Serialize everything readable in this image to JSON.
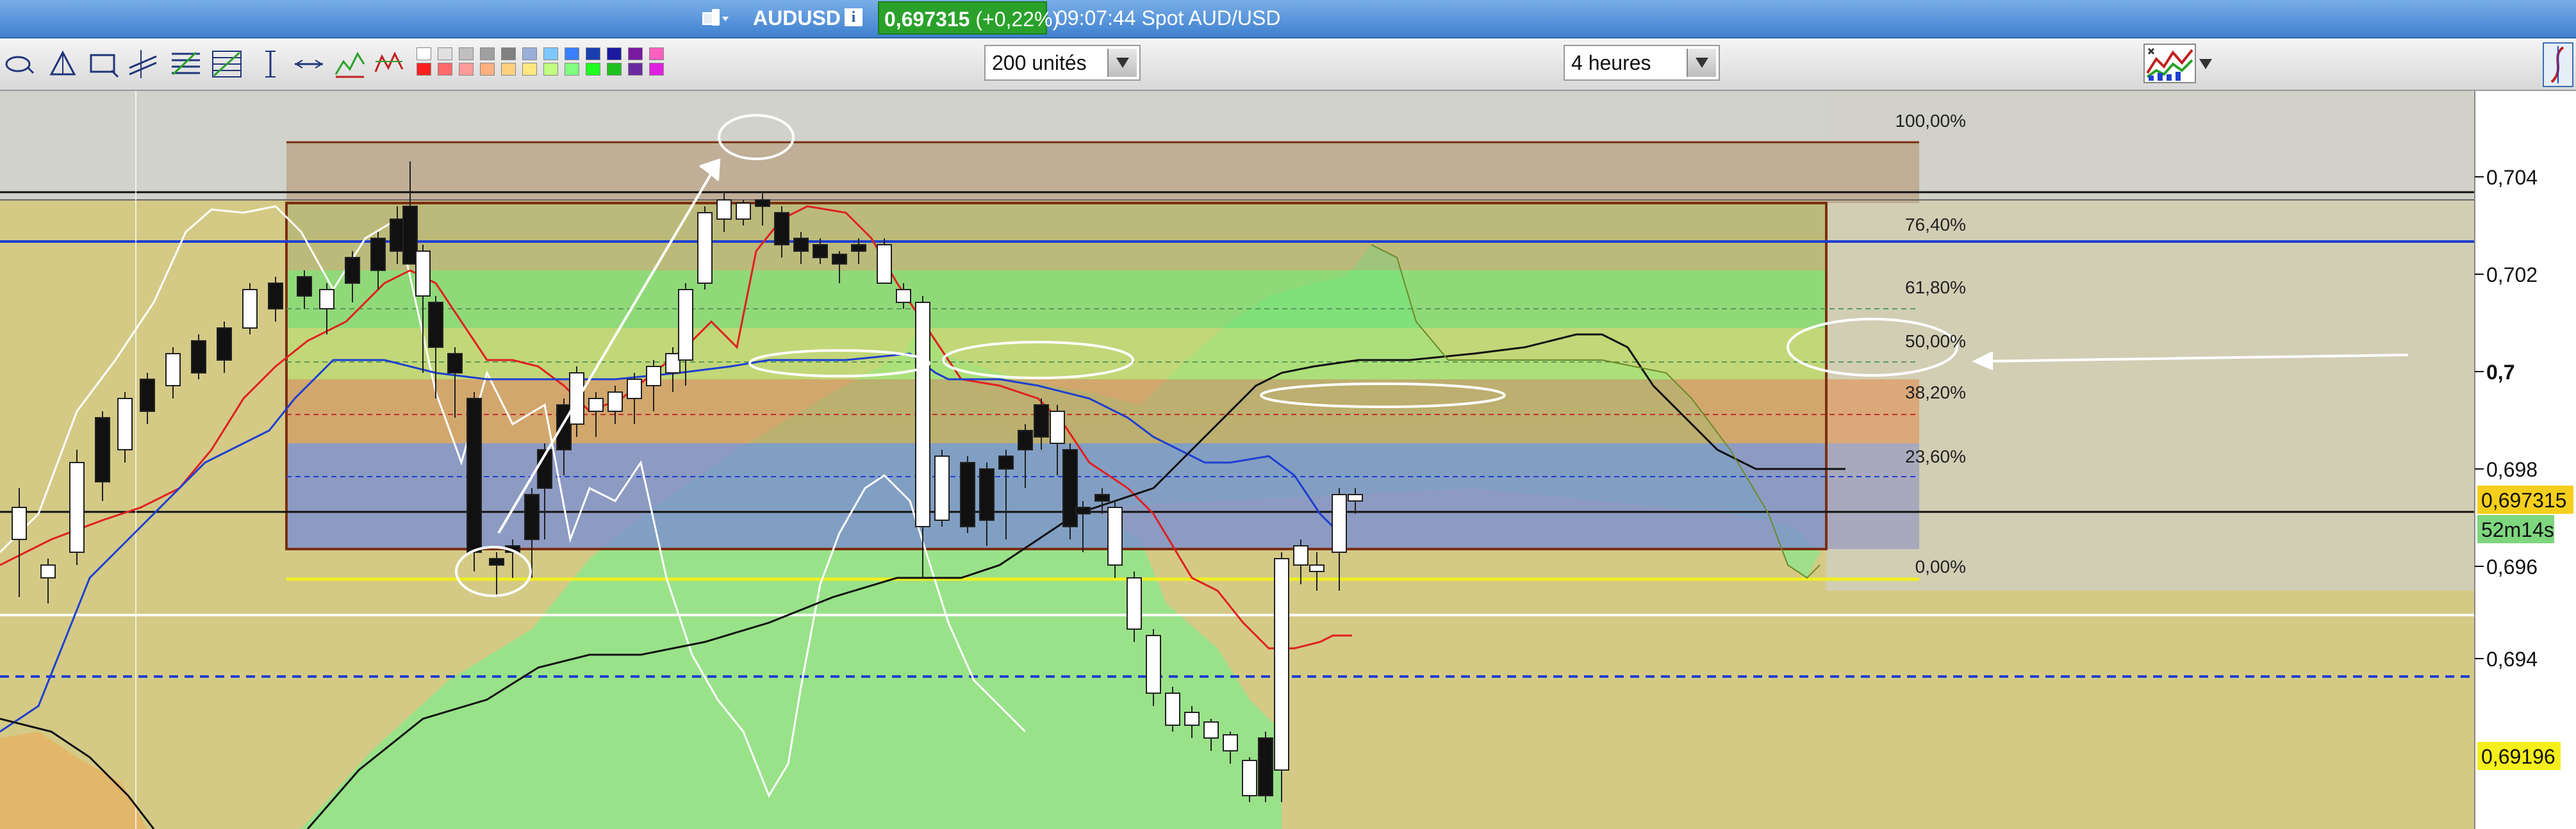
{
  "title_bar": {
    "instrument": "AUDUSD",
    "price": "0,697315",
    "change": "+0,22%",
    "time_and_name": "09:07:44 Spot AUD/USD"
  },
  "toolbar": {
    "units_select": "200 unités",
    "interval_select": "4 heures"
  },
  "price_axis": {
    "ticks": [
      "0,704",
      "0,702",
      "0,7",
      "0,698",
      "0,696",
      "0,694"
    ],
    "current_price": "0,697315",
    "countdown": "52m14s",
    "marker_price": "0,69196"
  },
  "fibonacci_levels": [
    "100,00%",
    "76,40%",
    "61,80%",
    "50,00%",
    "38,20%",
    "23,60%",
    "0,00%"
  ],
  "colors": {
    "title_bar": "#3f80cf",
    "change_badge": "#2aa12a",
    "chart_background": "#d4ca86",
    "price_tag": "#f5cf1c",
    "countdown_tag": "#7ed67e",
    "tenkan_line": "#e02020",
    "kijun_line": "#1f3fd1",
    "cloud_bull": "#8ee68a",
    "fib_zone_blue": "#7f8fd0",
    "fib_zone_red": "#d09070"
  },
  "icons": [
    "device-icon",
    "info-icon",
    "ellipse-tool-icon",
    "triangle-tool-icon",
    "rectangle-tool-icon",
    "channel-tool-icon",
    "fib-retracement-icon",
    "fib-fan-icon",
    "vertical-line-icon",
    "horizontal-line-icon",
    "zigzag-icon",
    "pattern-icon",
    "indicator-icon"
  ]
}
